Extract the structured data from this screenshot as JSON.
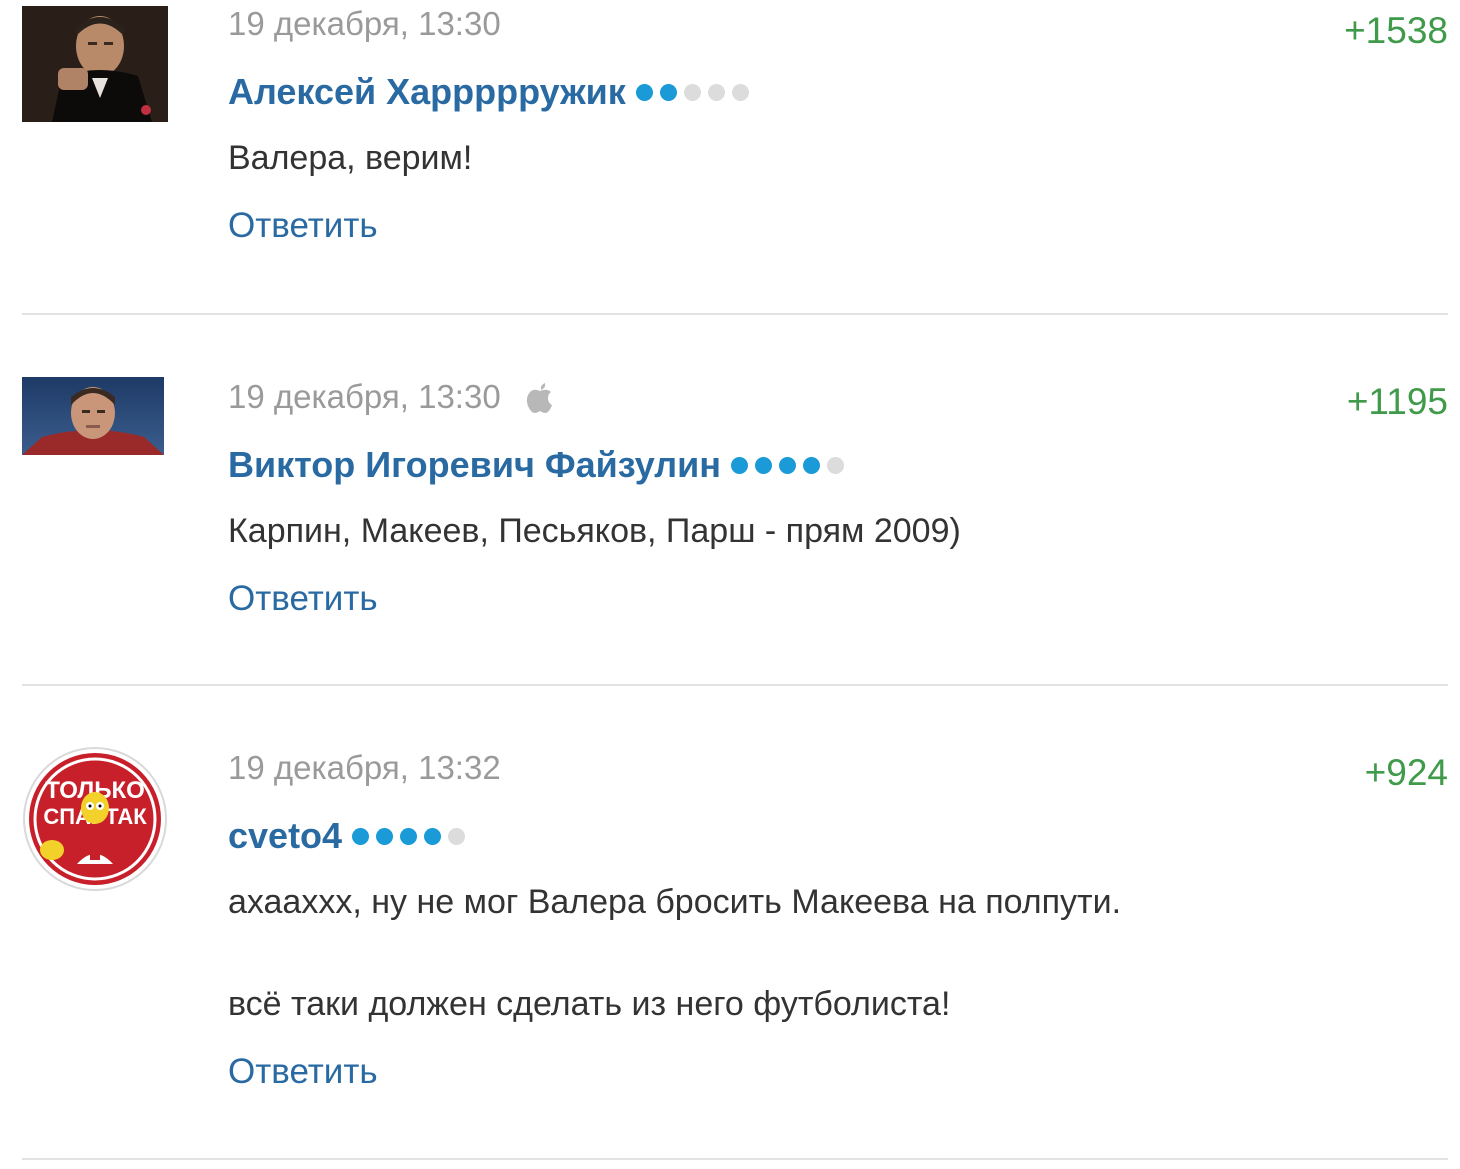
{
  "comments": [
    {
      "date": "19 декабря, 13:30",
      "author": "Алексей Харрррружик",
      "rating_filled": 2,
      "rating_total": 5,
      "score": "+1538",
      "text": [
        "Валера, верим!"
      ],
      "reply_label": "Ответить",
      "device_icon": null,
      "avatar_icon": "godfather-avatar"
    },
    {
      "date": "19 декабря, 13:30",
      "author": "Виктор Игоревич Файзулин",
      "rating_filled": 4,
      "rating_total": 5,
      "score": "+1195",
      "text": [
        "Карпин, Макеев, Песьяков, Парш - прям 2009)"
      ],
      "reply_label": "Ответить",
      "device_icon": "apple-icon",
      "avatar_icon": "player-avatar"
    },
    {
      "date": "19 декабря, 13:32",
      "author": "cveto4",
      "rating_filled": 4,
      "rating_total": 5,
      "score": "+924",
      "text": [
        "ахааххх, ну не мог Валера бросить Макеева на полпути.",
        "всё таки должен сделать из него футболиста!"
      ],
      "reply_label": "Ответить",
      "device_icon": null,
      "avatar_icon": "spartak-fan-avatar",
      "avatar_text": [
        "ТОЛЬКО",
        "СПАРТАК"
      ]
    }
  ],
  "colors": {
    "author": "#2a6aa3",
    "score": "#3f9a4a",
    "rating_on": "#1a9ad6",
    "rating_off": "#dcdcdc",
    "meta": "#9a9a9a",
    "divider": "#e3e3e3"
  }
}
